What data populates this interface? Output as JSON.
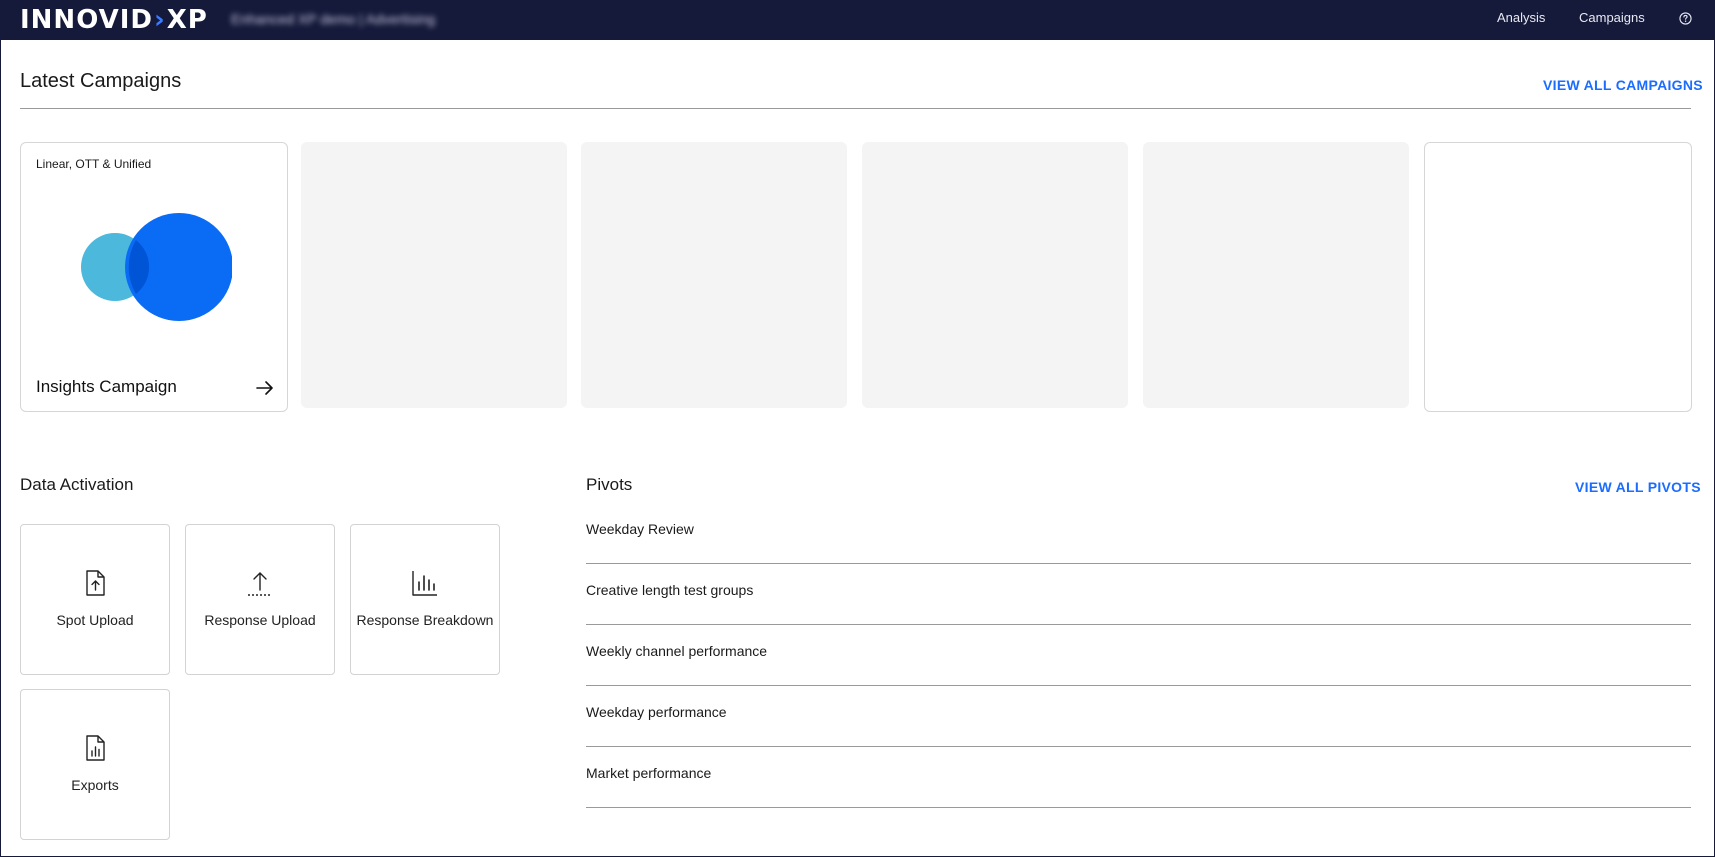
{
  "header": {
    "logo_text": "INNOVID",
    "logo_suffix": "XP",
    "environment_label": "Enhanced XP demo | Advertising",
    "nav": [
      {
        "label": "Analysis"
      },
      {
        "label": "Campaigns"
      }
    ],
    "help_icon": "help-circle-icon"
  },
  "latest_campaigns": {
    "title": "Latest Campaigns",
    "view_all_label": "VIEW ALL CAMPAIGNS",
    "cards": [
      {
        "tag": "Linear, OTT & Unified",
        "name": "Insights Campaign",
        "icon": "venn-diagram-icon",
        "arrow_icon": "arrow-right-icon",
        "colors": {
          "left_circle": "#4bb8dc",
          "right_circle": "#0a6cf5",
          "overlap": "#0054d6"
        }
      }
    ]
  },
  "data_activation": {
    "title": "Data Activation",
    "tiles": [
      {
        "label": "Spot Upload",
        "icon": "file-upload-icon"
      },
      {
        "label": "Response Upload",
        "icon": "upload-arrow-icon"
      },
      {
        "label": "Response Breakdown",
        "icon": "bar-chart-icon"
      },
      {
        "label": "Exports",
        "icon": "file-chart-icon"
      }
    ]
  },
  "pivots": {
    "title": "Pivots",
    "view_all_label": "VIEW ALL PIVOTS",
    "items": [
      {
        "label": "Weekday Review"
      },
      {
        "label": "Creative length test groups"
      },
      {
        "label": "Weekly channel performance"
      },
      {
        "label": "Weekday performance"
      },
      {
        "label": "Market performance"
      }
    ]
  },
  "colors": {
    "topbar": "#15193a",
    "link": "#1a6dff",
    "placeholder": "#f4f4f4"
  }
}
